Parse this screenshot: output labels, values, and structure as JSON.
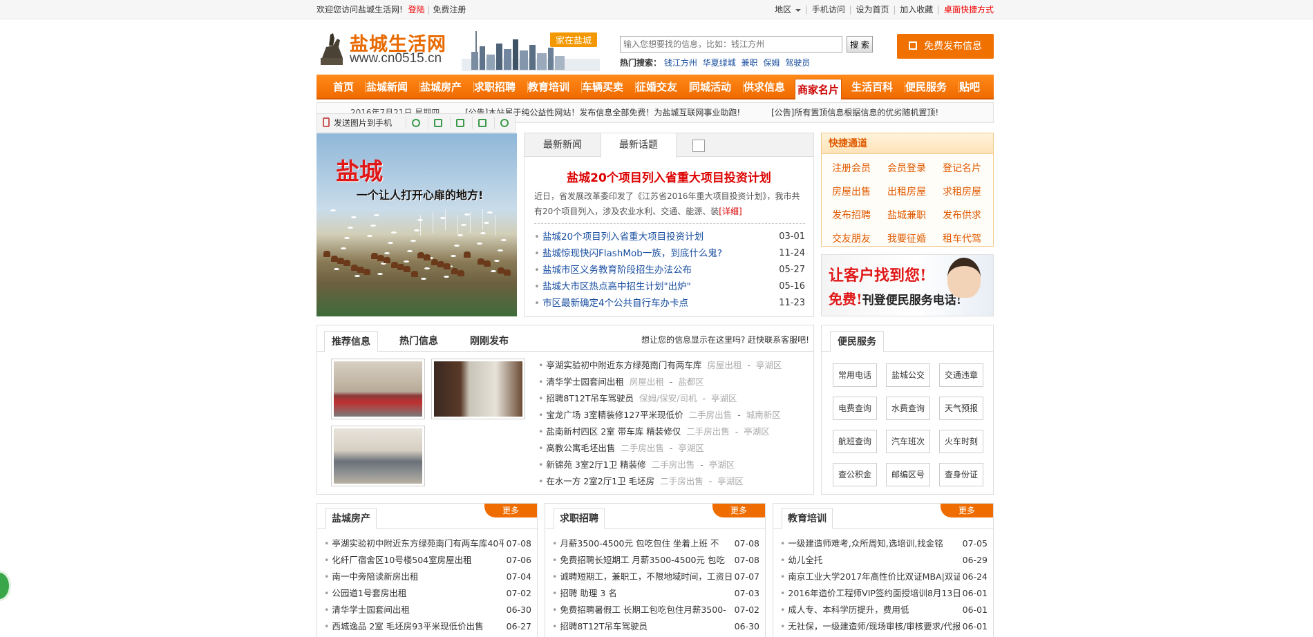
{
  "topbar": {
    "welcome": "欢迎您访问盐城生活网!",
    "login": "登陆",
    "register": "免费注册",
    "region": "地区",
    "mobile": "手机访问",
    "set_home": "设为首页",
    "favorite": "加入收藏",
    "desktop": "桌面快捷方式"
  },
  "header": {
    "logo_name": "盐城生活网",
    "logo_url": "www.cn0515.cn",
    "city_tag": "家在盐城",
    "search_placeholder": "输入您想要找的信息，比如：钱江方州",
    "search_button": "搜 索",
    "hot_label": "热门搜索：",
    "hot_keywords": [
      "钱江方州",
      "华夏绿城",
      "兼职",
      "保姆",
      "驾驶员"
    ],
    "post_button": "免费发布信息"
  },
  "nav": {
    "items": [
      "首页",
      "盐城新闻",
      "盐城房产",
      "求职招聘",
      "教育培训",
      "车辆买卖",
      "征婚交友",
      "同城活动",
      "供求信息",
      "商家名片",
      "生活百科",
      "便民服务",
      "贴吧"
    ],
    "active_index": 9
  },
  "notice": {
    "date": "2016年7月21日 星期四",
    "n1": "[公告]本站属于纯公益性网站！发布信息全部免费！为盐城互联网事业助跑!",
    "n2": "[公告]所有置顶信息根据信息的优劣随机置顶!"
  },
  "phonebar": {
    "send": "发送图片到手机"
  },
  "banner": {
    "title": "盐城",
    "slogan": "一个让人打开心扉的地方!"
  },
  "newsbox": {
    "tabs": [
      "最新新闻",
      "最新话题"
    ],
    "active_tab": 1,
    "headline": "盐城20个项目列入省重大项目投资计划",
    "summary": "近日，省发展改革委印发了《江苏省2016年重大项目投资计划》，我市共有20个项目列入，涉及农业水利、交通、能源、装",
    "summary_more": "[详细]",
    "items": [
      {
        "title": "盐城20个项目列入省重大项目投资计划",
        "date": "03-01"
      },
      {
        "title": "盐城惊现快闪FlashMob一族，到底什么鬼?",
        "date": "11-24"
      },
      {
        "title": "盐城市区义务教育阶段招生办法公布",
        "date": "05-27"
      },
      {
        "title": "盐城大市区热点高中招生计划\"出炉\"",
        "date": "05-16"
      },
      {
        "title": "市区最新确定4个公共自行车办卡点",
        "date": "11-23"
      }
    ]
  },
  "quick": {
    "title": "快捷通道",
    "links": [
      "注册会员",
      "会员登录",
      "登记名片",
      "房屋出售",
      "出租房屋",
      "求租房屋",
      "发布招聘",
      "盐城兼职",
      "发布供求",
      "交友朋友",
      "我要征婚",
      "租车代驾"
    ]
  },
  "ad": {
    "line1": "让客户找到您!",
    "line2": "免费!",
    "line2b": "刊登便民服务电话!"
  },
  "rec": {
    "tabs": [
      "推荐信息",
      "热门信息",
      "刚刚发布"
    ],
    "cta": "想让您的信息显示在这里吗? 赶快联系客服吧!",
    "items": [
      {
        "title": "亭湖实验初中附近东方绿苑南门有两车库",
        "cat": "房屋出租",
        "area": "亭湖区"
      },
      {
        "title": "清华学士园套间出租",
        "cat": "房屋出租",
        "area": "盐都区"
      },
      {
        "title": "招聘8T12T吊车驾驶员",
        "cat": "保姆/保安/司机",
        "area": "亭湖区"
      },
      {
        "title": "宝龙广场 3室精装修127平米现低价",
        "cat": "二手房出售",
        "area": "城南新区"
      },
      {
        "title": "盐南新村四区 2室 带车库 精装修仅",
        "cat": "二手房出售",
        "area": "亭湖区"
      },
      {
        "title": "高教公寓毛坯出售",
        "cat": "二手房出售",
        "area": "亭湖区"
      },
      {
        "title": "新锦苑 3室2厅1卫 精装修",
        "cat": "二手房出售",
        "area": "亭湖区"
      },
      {
        "title": "在水一方 2室2厅1卫 毛坯房",
        "cat": "二手房出售",
        "area": "亭湖区"
      }
    ]
  },
  "svc": {
    "title": "便民服务",
    "buttons": [
      "常用电话",
      "盐城公交",
      "交通违章",
      "电费查询",
      "水费查询",
      "天气预报",
      "航班查询",
      "汽车班次",
      "火车时刻",
      "查公积金",
      "邮编区号",
      "查身份证"
    ]
  },
  "cats": [
    {
      "title": "盐城房产",
      "more": "更多",
      "items": [
        {
          "title": "亭湖实验初中附近东方绿苑南门有两车库40平",
          "date": "07-08"
        },
        {
          "title": "化纤厂宿舍区10号楼504室房屋出租",
          "date": "07-06"
        },
        {
          "title": "南一中旁陪读新房出租",
          "date": "07-04"
        },
        {
          "title": "公园道1号套房出租",
          "date": "07-02"
        },
        {
          "title": "清华学士园套间出租",
          "date": "06-30"
        },
        {
          "title": "西城逸品 2室 毛坯房93平米现低价出售",
          "date": "06-27"
        }
      ]
    },
    {
      "title": "求职招聘",
      "more": "更多",
      "items": [
        {
          "title": "月薪3500-4500元 包吃包住 坐着上班 不",
          "date": "07-08"
        },
        {
          "title": "免费招聘长短期工 月薪3500-4500元 包吃",
          "date": "07-08"
        },
        {
          "title": "诚聘短期工，兼职工，不限地域时间，工资日",
          "date": "07-07"
        },
        {
          "title": "招聘 助理 3 名",
          "date": "07-03"
        },
        {
          "title": "免费招聘暑假工 长期工包吃包住月薪3500-",
          "date": "07-02"
        },
        {
          "title": "招聘8T12T吊车驾驶员",
          "date": "06-30"
        }
      ]
    },
    {
      "title": "教育培训",
      "more": "更多",
      "items": [
        {
          "title": "一级建造师难考,众所周知,选培训,找金铭",
          "date": "07-05"
        },
        {
          "title": "幼儿全托",
          "date": "06-29"
        },
        {
          "title": "南京工业大学2017年高性价比双证MBA|双证",
          "date": "06-24"
        },
        {
          "title": "2016年造价工程师VIP签约面授培训8月13日",
          "date": "06-01"
        },
        {
          "title": "成人专、本科学历提升，费用低",
          "date": "06-01"
        },
        {
          "title": "无社保，一级建造师/现场审核/审核要求/代报",
          "date": "06-01"
        }
      ]
    }
  ]
}
